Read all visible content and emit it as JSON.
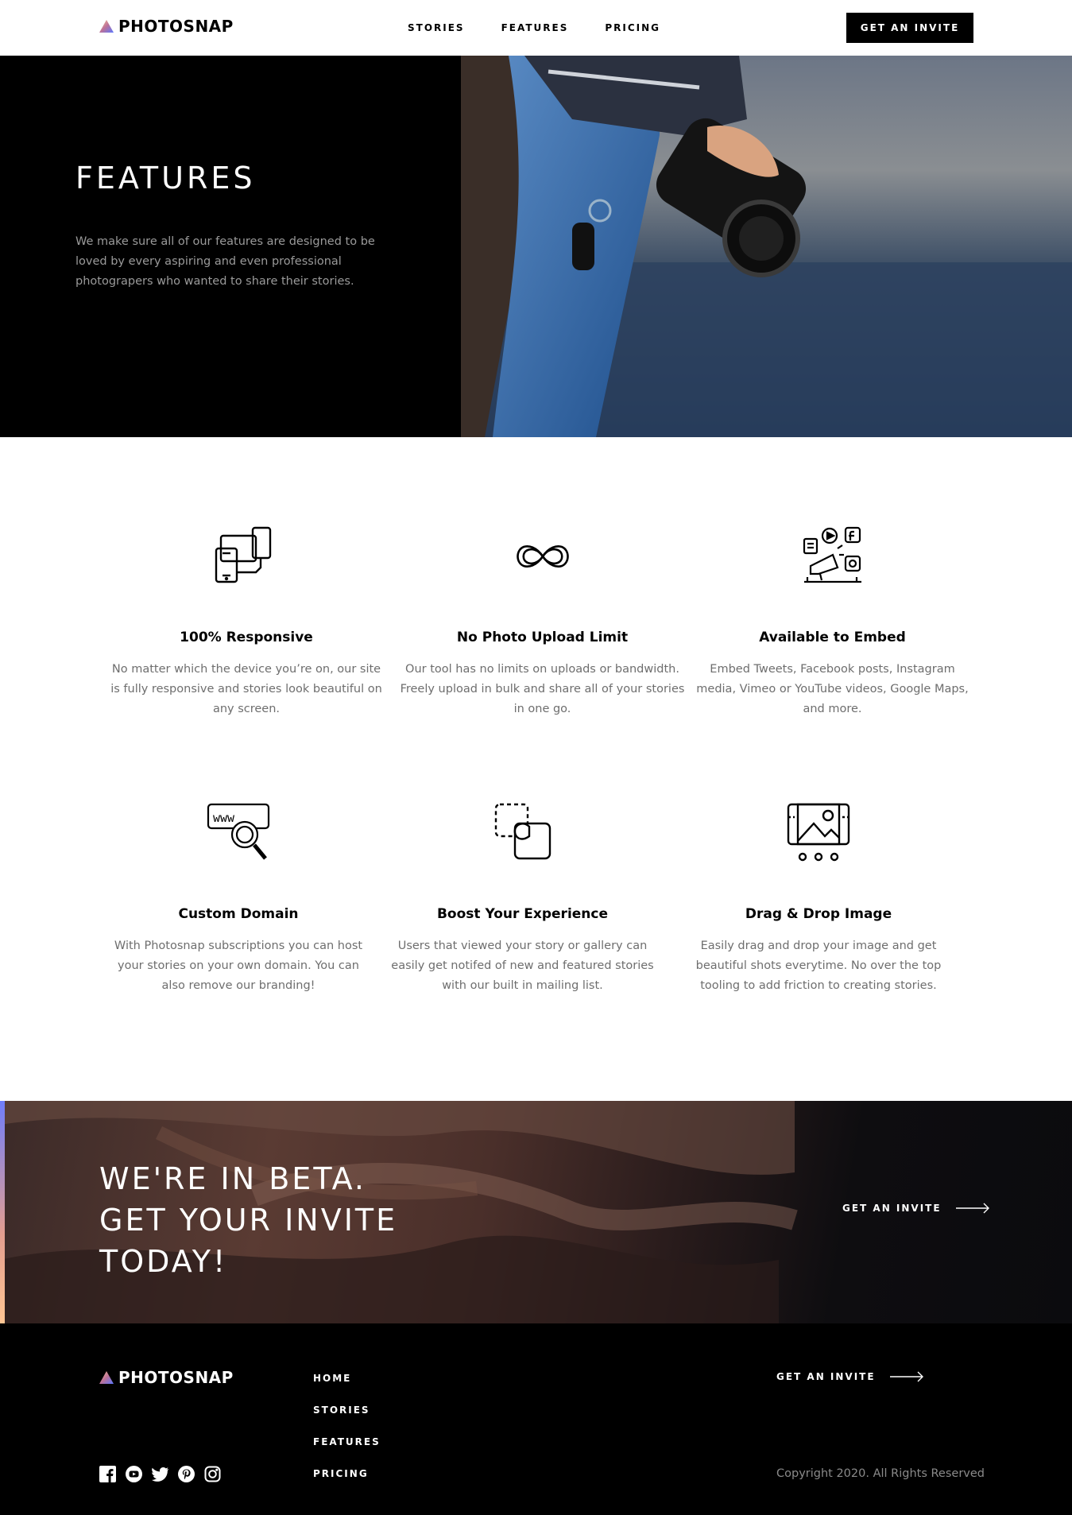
{
  "brand": {
    "name": "PHOTOSNAP",
    "logo_icon": "triangle-gradient-icon",
    "accent_gradient": [
      "#FFC593",
      "#BC7198",
      "#5A77FF"
    ]
  },
  "header": {
    "nav": [
      "STORIES",
      "FEATURES",
      "PRICING"
    ],
    "cta_label": "GET AN INVITE"
  },
  "hero": {
    "title": "FEATURES",
    "text": "We make sure all of our features are designed to be loved by every aspiring and even professional photograpers who wanted to share their stories.",
    "image": "photographer-holding-camera-photo"
  },
  "features": [
    {
      "icon": "responsive-devices-icon",
      "title": "100% Responsive",
      "desc": "No matter which the device you’re on, our site is fully responsive and stories look beautiful on any screen."
    },
    {
      "icon": "infinity-icon",
      "title": "No Photo Upload Limit",
      "desc": "Our tool has no limits on uploads or bandwidth. Freely upload in bulk and share all of your stories in one go."
    },
    {
      "icon": "embed-media-icon",
      "title": "Available to Embed",
      "desc": "Embed Tweets, Facebook posts, Instagram media, Vimeo or YouTube videos, Google Maps, and more."
    },
    {
      "icon": "custom-domain-icon",
      "title": "Custom Domain",
      "desc": "With Photosnap subscriptions you can host your stories on your own domain. You can also remove our branding!"
    },
    {
      "icon": "boost-experience-icon",
      "title": "Boost Your Experience",
      "desc": "Users that viewed your story or gallery can easily get notifed of new and featured stories with our built in mailing list."
    },
    {
      "icon": "drag-drop-image-icon",
      "title": "Drag & Drop Image",
      "desc": "Easily drag and drop your image and get beautiful shots everytime. No over the top tooling to add friction to creating stories."
    }
  ],
  "beta": {
    "title_lines": [
      "WE'RE IN BETA.",
      "GET YOUR INVITE",
      "TODAY!"
    ],
    "cta_label": "GET AN INVITE",
    "image": "canyon-rock-photo"
  },
  "footer": {
    "nav": [
      "HOME",
      "STORIES",
      "FEATURES",
      "PRICING"
    ],
    "cta_label": "GET AN INVITE",
    "socials": [
      "facebook-icon",
      "youtube-icon",
      "twitter-icon",
      "pinterest-icon",
      "instagram-icon"
    ],
    "copyright": "Copyright 2020. All Rights Reserved"
  }
}
